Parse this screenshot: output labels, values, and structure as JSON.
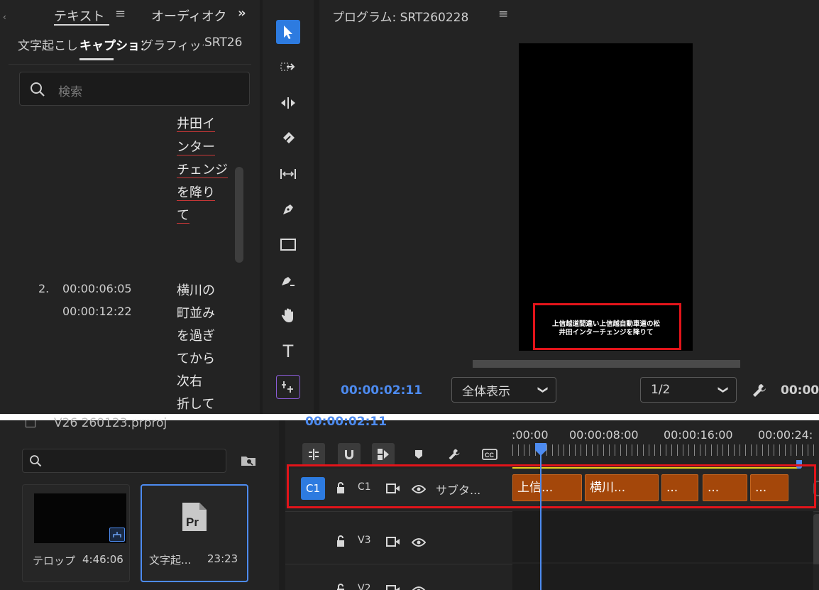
{
  "left_panel": {
    "tabs": [
      "テキスト",
      "オーディオク"
    ],
    "more_label": "»",
    "subtabs": [
      "文字起こし",
      "キャプション",
      "グラフィック",
      "SRT26"
    ],
    "search_placeholder": "検索",
    "caption_partial_lines": [
      "井田イ",
      "ンター",
      "チェンジ",
      "を降り",
      "て"
    ],
    "caption_2": {
      "number": "2.",
      "start": "00:00:06:05",
      "end": "00:00:12:22",
      "lines": [
        "横川の",
        "町並み",
        "を過ぎ",
        "てから",
        "次右",
        "折して"
      ]
    }
  },
  "monitor": {
    "title": "プログラム: SRT260228",
    "menu_icon": "≡",
    "overlay_line1": "上信越道間違い上信越自動車道の松",
    "overlay_line2": "井田インターチェンジを降りて",
    "timecode": "00:00:02:11",
    "fit_label": "全体表示",
    "resolution_label": "1/2",
    "timecode_right": "00:00"
  },
  "project": {
    "title": "V26 260123.prproj",
    "bins": [
      {
        "name": "テロップ",
        "duration": "4:46:06"
      },
      {
        "name": "文字起...",
        "duration": "23:23"
      }
    ]
  },
  "timeline": {
    "timecode": "00:00:02:11",
    "ruler": [
      ":00:00",
      "00:00:08:00",
      "00:00:16:00",
      "00:00:24:"
    ],
    "caption_track": {
      "badge": "C1",
      "name": "C1",
      "label": "サブタ..."
    },
    "clips": [
      "上信...",
      "横川...",
      "...",
      "...",
      "..."
    ],
    "tracks": [
      {
        "name": "V3"
      },
      {
        "name": "V2"
      }
    ],
    "accent": "#4d8bf0",
    "clip_color": "#a4470a",
    "highlight_color": "#e2141a"
  }
}
